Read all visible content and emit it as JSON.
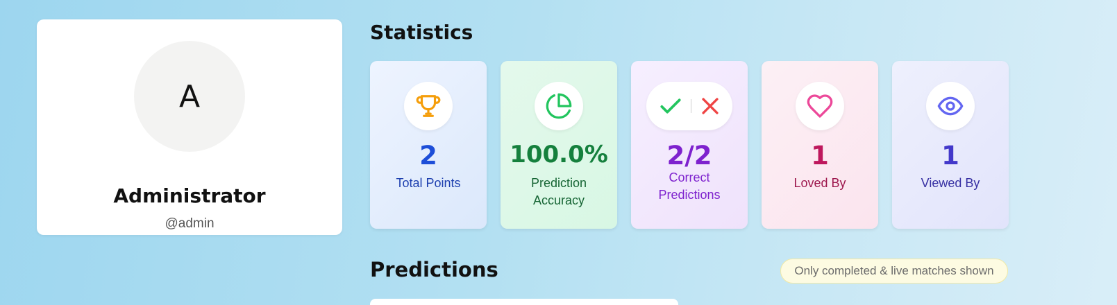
{
  "profile": {
    "avatar_letter": "A",
    "name": "Administrator",
    "handle": "@admin"
  },
  "statistics": {
    "title": "Statistics",
    "cards": [
      {
        "value": "2",
        "label": "Total Points",
        "icon": "trophy-icon",
        "color": "#1d4ed8"
      },
      {
        "value": "100.0%",
        "label": "Prediction Accuracy",
        "icon": "pie-chart-icon",
        "color": "#15803d"
      },
      {
        "value": "2/2",
        "label": "Correct Predictions",
        "icon": "check-cross-icon",
        "color": "#7e22ce"
      },
      {
        "value": "1",
        "label": "Loved By",
        "icon": "heart-icon",
        "color": "#be185d"
      },
      {
        "value": "1",
        "label": "Viewed By",
        "icon": "eye-icon",
        "color": "#4338ca"
      }
    ]
  },
  "predictions": {
    "title": "Predictions",
    "notice": "Only completed & live matches shown"
  },
  "colors": {
    "trophy": "#f59e0b",
    "pie": "#22c55e",
    "check": "#22c55e",
    "cross": "#ef4444",
    "heart": "#ec4899",
    "eye": "#6366f1"
  }
}
